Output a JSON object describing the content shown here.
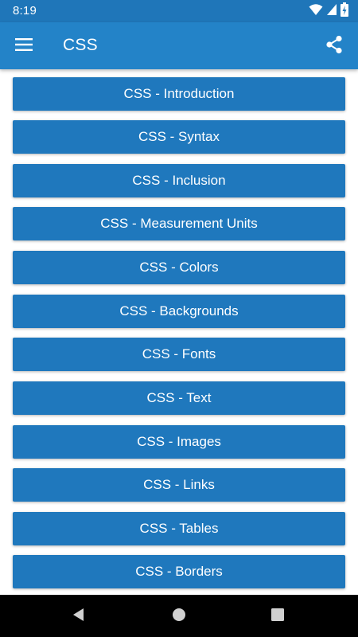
{
  "status_bar": {
    "time": "8:19",
    "icons": [
      "wifi-icon",
      "cell-signal-icon",
      "battery-charging-icon"
    ]
  },
  "app_bar": {
    "title": "CSS",
    "menu_icon": "hamburger-menu-icon",
    "share_icon": "share-icon",
    "color": "#2383c8"
  },
  "topics": [
    {
      "label": "CSS - Introduction"
    },
    {
      "label": "CSS - Syntax"
    },
    {
      "label": "CSS - Inclusion"
    },
    {
      "label": "CSS - Measurement Units"
    },
    {
      "label": "CSS - Colors"
    },
    {
      "label": "CSS - Backgrounds"
    },
    {
      "label": "CSS - Fonts"
    },
    {
      "label": "CSS - Text"
    },
    {
      "label": "CSS - Images"
    },
    {
      "label": "CSS - Links"
    },
    {
      "label": "CSS - Tables"
    },
    {
      "label": "CSS - Borders"
    }
  ],
  "nav_bar": {
    "icons": [
      "back-icon",
      "home-icon",
      "recents-icon"
    ]
  }
}
